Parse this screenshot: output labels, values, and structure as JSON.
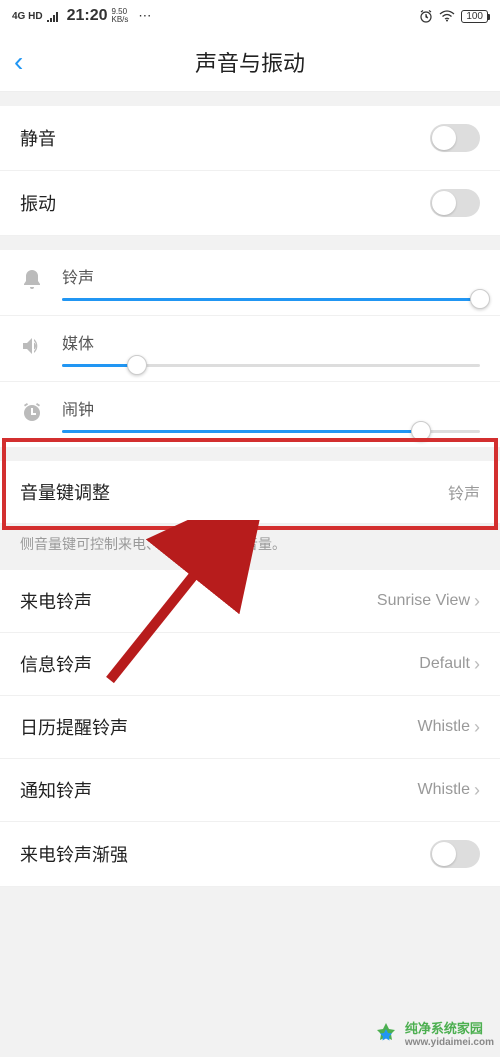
{
  "status_bar": {
    "network": "4G HD",
    "time": "21:20",
    "speed_num": "9.50",
    "speed_unit": "KB/s",
    "battery": "100"
  },
  "header": {
    "title": "声音与振动"
  },
  "toggles": {
    "mute": {
      "label": "静音",
      "on": false
    },
    "vibrate": {
      "label": "振动",
      "on": false
    }
  },
  "sliders": {
    "ringtone": {
      "label": "铃声",
      "value": 100
    },
    "media": {
      "label": "媒体",
      "value": 18
    },
    "alarm": {
      "label": "闹钟",
      "value": 86
    }
  },
  "volume_key": {
    "label": "音量键调整",
    "value": "铃声",
    "desc": "侧音量键可控制来电、信息和通知的音量。"
  },
  "ringtones": {
    "incoming": {
      "label": "来电铃声",
      "value": "Sunrise View"
    },
    "message": {
      "label": "信息铃声",
      "value": "Default"
    },
    "calendar": {
      "label": "日历提醒铃声",
      "value": "Whistle"
    },
    "notification": {
      "label": "通知铃声",
      "value": "Whistle"
    },
    "ascending": {
      "label": "来电铃声渐强"
    }
  },
  "watermark": {
    "name": "纯净系统家园",
    "url": "www.yidaimei.com"
  }
}
